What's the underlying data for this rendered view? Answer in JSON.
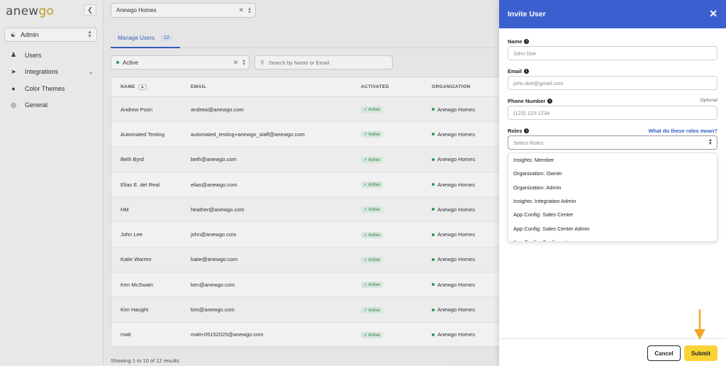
{
  "sidebar": {
    "logo_prefix": "anew",
    "logo_suffix": "go",
    "collapse_icon": "chevron-left-icon",
    "org_selector": "Admin",
    "items": [
      {
        "label": "Users",
        "icon": "users-icon"
      },
      {
        "label": "Integrations",
        "icon": "send-icon"
      },
      {
        "label": "Color Themes",
        "icon": "palette-icon"
      },
      {
        "label": "General",
        "icon": "globe-icon"
      }
    ]
  },
  "topbar": {
    "home_select": "Anewgo Homes"
  },
  "tabs": [
    {
      "label": "Manage Users",
      "count": "12"
    }
  ],
  "filters": {
    "status": "Active",
    "search_placeholder": "Search by Name or Email"
  },
  "table": {
    "columns": [
      "NAME",
      "EMAIL",
      "ACTIVATED",
      "ORGANIZATION"
    ],
    "rows": [
      {
        "name": "Andrew Poon",
        "email": "andrew@anewgo.com",
        "activated": "Active",
        "org": "Anewgo Homes"
      },
      {
        "name": "Automated Testing",
        "email": "automated_testing+anewgo_staff@anewgo.com",
        "activated": "Active",
        "org": "Anewgo Homes"
      },
      {
        "name": "Beth Byrd",
        "email": "beth@anewgo.com",
        "activated": "Active",
        "org": "Anewgo Homes"
      },
      {
        "name": "Elias E. del Real",
        "email": "elias@anewgo.com",
        "activated": "Active",
        "org": "Anewgo Homes"
      },
      {
        "name": "HM",
        "email": "heather@anewgo.com",
        "activated": "Active",
        "org": "Anewgo Homes"
      },
      {
        "name": "John Lee",
        "email": "john@anewgo.com",
        "activated": "Active",
        "org": "Anewgo Homes"
      },
      {
        "name": "Katie Warren",
        "email": "katie@anewgo.com",
        "activated": "Active",
        "org": "Anewgo Homes"
      },
      {
        "name": "Ken McSwain",
        "email": "ken@anewgo.com",
        "activated": "Active",
        "org": "Anewgo Homes"
      },
      {
        "name": "Kim Haught",
        "email": "kim@anewgo.com",
        "activated": "Active",
        "org": "Anewgo Homes"
      },
      {
        "name": "matt",
        "email": "matt+05152025@anewgo.com",
        "activated": "Active",
        "org": "Anewgo Homes"
      }
    ],
    "footer": "Showing 1 to 10 of 12 results"
  },
  "modal": {
    "title": "Invite User",
    "name_label": "Name",
    "name_placeholder": "John Doe",
    "email_label": "Email",
    "email_placeholder": "john.doe@gmail.com",
    "phone_label": "Phone Number",
    "phone_optional": "Optional",
    "phone_placeholder": "(123) 123-1234",
    "roles_label": "Roles",
    "roles_help": "What do these roles mean?",
    "roles_placeholder": "Select Roles",
    "role_options": [
      "Insights: Member",
      "Organization: Owner",
      "Organization: Admin",
      "Insights: Integration Admin",
      "App Config: Sales Center",
      "App Config: Sales Center Admin",
      "App Config: Configurator"
    ],
    "cancel_label": "Cancel",
    "submit_label": "Submit"
  },
  "colors": {
    "header_blue": "#3c5fd0",
    "submit_yellow": "#f9d234",
    "arrow_orange": "#f5a623",
    "active_green": "#2e9e4f"
  }
}
